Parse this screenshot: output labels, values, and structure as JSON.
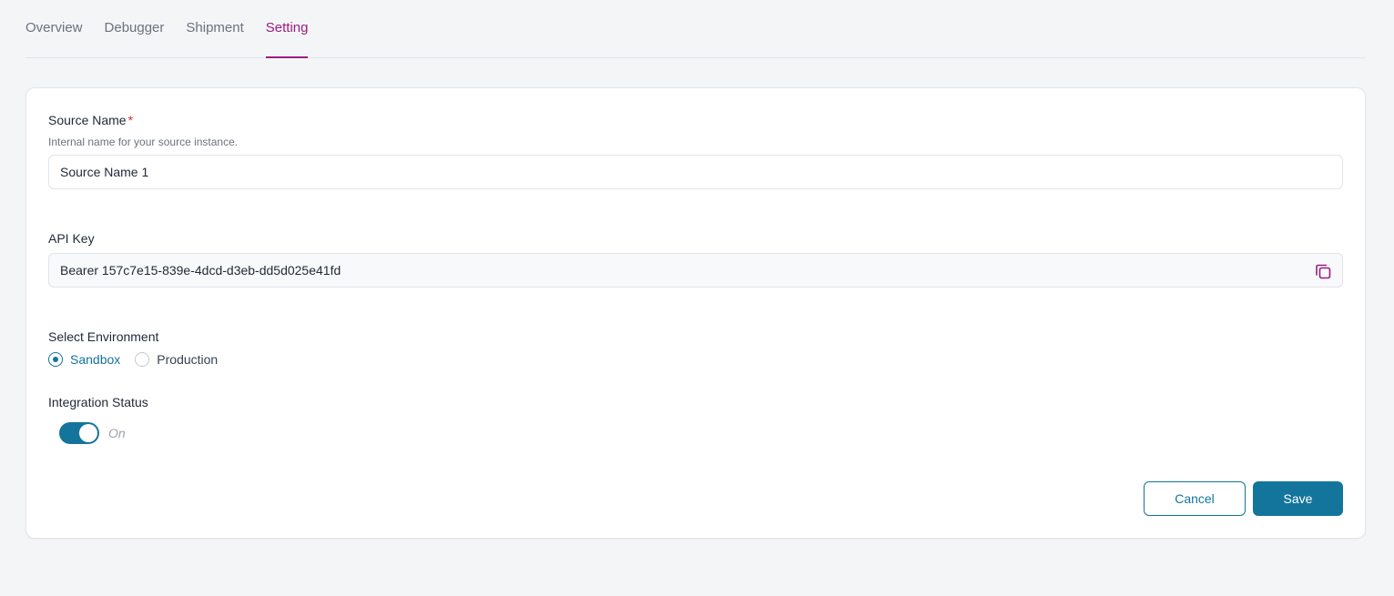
{
  "tabs": [
    {
      "label": "Overview",
      "active": false
    },
    {
      "label": "Debugger",
      "active": false
    },
    {
      "label": "Shipment",
      "active": false
    },
    {
      "label": "Setting",
      "active": true
    }
  ],
  "form": {
    "source_name": {
      "label": "Source Name",
      "required_mark": "*",
      "helper": "Internal name for your source instance.",
      "value": "Source Name 1"
    },
    "api_key": {
      "label": "API Key",
      "value": "Bearer 157c7e15-839e-4dcd-d3eb-dd5d025e41fd",
      "copy_icon": "copy-icon"
    },
    "environment": {
      "label": "Select Environment",
      "options": [
        {
          "label": "Sandbox",
          "selected": true
        },
        {
          "label": "Production",
          "selected": false
        }
      ]
    },
    "integration_status": {
      "label": "Integration Status",
      "enabled": true,
      "state_text": "On"
    }
  },
  "actions": {
    "cancel_label": "Cancel",
    "save_label": "Save"
  },
  "colors": {
    "accent": "#13759b",
    "active_tab": "#9b1d7f",
    "required": "#dc2626"
  }
}
